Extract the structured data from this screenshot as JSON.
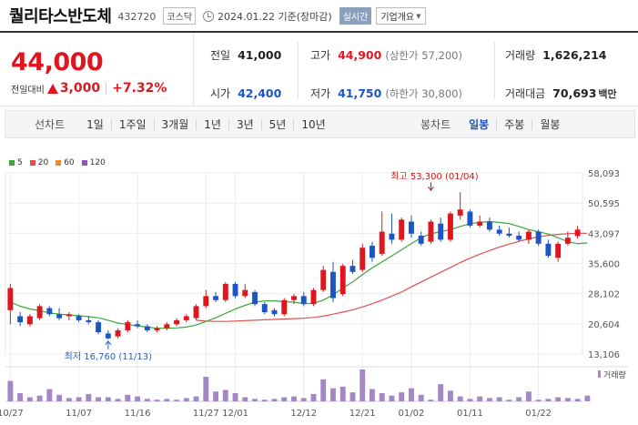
{
  "header": {
    "stock_name": "퀄리타스반도체",
    "stock_code": "432720",
    "market": "코스닥",
    "date_text": "2024.01.22 기준(장마감)",
    "realtime_label": "실시간",
    "company_label": "기업개요"
  },
  "price": {
    "current": "44,000",
    "change_label": "전일대비",
    "change_amount": "3,000",
    "change_pct": "+7.32%"
  },
  "stats": {
    "prev_label": "전일",
    "prev_value": "41,000",
    "high_label": "고가",
    "high_value": "44,900",
    "high_limit": "(상한가 57,200)",
    "volume_label": "거래량",
    "volume_value": "1,626,214",
    "open_label": "시가",
    "open_value": "42,400",
    "low_label": "저가",
    "low_value": "41,750",
    "low_limit": "(하한가 30,800)",
    "amount_label": "거래대금",
    "amount_value": "70,693",
    "amount_unit": "백만"
  },
  "toolbar": {
    "line_label": "선차트",
    "line_items": [
      "1일",
      "1주일",
      "3개월",
      "1년",
      "3년",
      "5년",
      "10년"
    ],
    "candle_label": "봉차트",
    "candle_items": [
      "일봉",
      "주봉",
      "월봉"
    ],
    "candle_active": "일봉"
  },
  "colors": {
    "up": "#e0161e",
    "down": "#1d55c4",
    "ma5": "#3ca53c",
    "ma20": "#e05050",
    "ma60": "#f08a24",
    "ma120": "#8b5ab8",
    "volume": "#a487c5"
  },
  "chart_data": {
    "type": "candlestick",
    "legend": [
      {
        "name": "5",
        "color": "#3ca53c"
      },
      {
        "name": "20",
        "color": "#e05050"
      },
      {
        "name": "60",
        "color": "#f08a24"
      },
      {
        "name": "120",
        "color": "#8b5ab8"
      }
    ],
    "y_ticks": [
      58093,
      50595,
      43097,
      35600,
      28102,
      20604,
      13106
    ],
    "y_tick_labels": [
      "58,093",
      "50,595",
      "43,097",
      "35,600",
      "28,102",
      "20,604",
      "13,106"
    ],
    "ylim": [
      13106,
      58093
    ],
    "x_tick_labels": [
      "10/27",
      "11/07",
      "11/16",
      "11/27",
      "12/01",
      "12/12",
      "12/21",
      "01/02",
      "01/11",
      "01/22"
    ],
    "x_tick_index": [
      0,
      7,
      13,
      20,
      23,
      30,
      36,
      41,
      47,
      54
    ],
    "high_annotation": "최고 53,300 (01/04)",
    "high_annotation_index": 43,
    "high_annotation_value": 53300,
    "low_annotation": "최저 16,760 (11/13)",
    "low_annotation_index": 10,
    "low_annotation_value": 16760,
    "volume_label": "거래량",
    "candles": [
      {
        "o": 24000,
        "h": 30500,
        "l": 20500,
        "c": 29500
      },
      {
        "o": 22500,
        "h": 23500,
        "l": 20000,
        "c": 21000
      },
      {
        "o": 20500,
        "h": 23000,
        "l": 20000,
        "c": 22500
      },
      {
        "o": 22000,
        "h": 25500,
        "l": 21500,
        "c": 25000
      },
      {
        "o": 24500,
        "h": 25000,
        "l": 22500,
        "c": 23000
      },
      {
        "o": 23000,
        "h": 24500,
        "l": 21500,
        "c": 22000
      },
      {
        "o": 22500,
        "h": 23500,
        "l": 21500,
        "c": 23000
      },
      {
        "o": 22500,
        "h": 23000,
        "l": 21000,
        "c": 21500
      },
      {
        "o": 21500,
        "h": 22500,
        "l": 20500,
        "c": 21000
      },
      {
        "o": 21000,
        "h": 21500,
        "l": 18000,
        "c": 18500
      },
      {
        "o": 18200,
        "h": 19000,
        "l": 16760,
        "c": 17000
      },
      {
        "o": 17500,
        "h": 19500,
        "l": 17000,
        "c": 19000
      },
      {
        "o": 19000,
        "h": 21500,
        "l": 18500,
        "c": 21000
      },
      {
        "o": 20500,
        "h": 21500,
        "l": 19500,
        "c": 20000
      },
      {
        "o": 20000,
        "h": 20500,
        "l": 18500,
        "c": 19000
      },
      {
        "o": 19000,
        "h": 20000,
        "l": 18500,
        "c": 19500
      },
      {
        "o": 19500,
        "h": 21000,
        "l": 19000,
        "c": 20500
      },
      {
        "o": 20500,
        "h": 22000,
        "l": 20000,
        "c": 21500
      },
      {
        "o": 21500,
        "h": 23000,
        "l": 21000,
        "c": 22500
      },
      {
        "o": 22000,
        "h": 25500,
        "l": 21500,
        "c": 25000
      },
      {
        "o": 25000,
        "h": 29000,
        "l": 24500,
        "c": 27500
      },
      {
        "o": 27500,
        "h": 28500,
        "l": 26000,
        "c": 26500
      },
      {
        "o": 26500,
        "h": 31000,
        "l": 26000,
        "c": 30500
      },
      {
        "o": 30500,
        "h": 31000,
        "l": 27000,
        "c": 27500
      },
      {
        "o": 27500,
        "h": 30500,
        "l": 27000,
        "c": 29000
      },
      {
        "o": 28500,
        "h": 29000,
        "l": 25000,
        "c": 25500
      },
      {
        "o": 25500,
        "h": 26000,
        "l": 23000,
        "c": 23500
      },
      {
        "o": 24000,
        "h": 24500,
        "l": 22500,
        "c": 23000
      },
      {
        "o": 23000,
        "h": 27000,
        "l": 22500,
        "c": 26500
      },
      {
        "o": 26500,
        "h": 28000,
        "l": 25500,
        "c": 27500
      },
      {
        "o": 27500,
        "h": 28500,
        "l": 25000,
        "c": 25500
      },
      {
        "o": 25500,
        "h": 29500,
        "l": 25000,
        "c": 29000
      },
      {
        "o": 29000,
        "h": 35000,
        "l": 28500,
        "c": 34000
      },
      {
        "o": 33500,
        "h": 36000,
        "l": 26000,
        "c": 27000
      },
      {
        "o": 28000,
        "h": 35500,
        "l": 27500,
        "c": 35000
      },
      {
        "o": 35000,
        "h": 36500,
        "l": 33000,
        "c": 33500
      },
      {
        "o": 34000,
        "h": 40500,
        "l": 33500,
        "c": 39500
      },
      {
        "o": 40000,
        "h": 41000,
        "l": 36000,
        "c": 37000
      },
      {
        "o": 38000,
        "h": 48500,
        "l": 37500,
        "c": 43500
      },
      {
        "o": 43000,
        "h": 48000,
        "l": 40500,
        "c": 41500
      },
      {
        "o": 41500,
        "h": 47000,
        "l": 41000,
        "c": 46500
      },
      {
        "o": 46000,
        "h": 47500,
        "l": 42000,
        "c": 43000
      },
      {
        "o": 42500,
        "h": 43500,
        "l": 40000,
        "c": 40500
      },
      {
        "o": 41000,
        "h": 46500,
        "l": 40500,
        "c": 46000
      },
      {
        "o": 45500,
        "h": 47000,
        "l": 41000,
        "c": 41500
      },
      {
        "o": 41500,
        "h": 48500,
        "l": 41000,
        "c": 48000
      },
      {
        "o": 47500,
        "h": 53300,
        "l": 46500,
        "c": 49000
      },
      {
        "o": 48500,
        "h": 49000,
        "l": 44500,
        "c": 45000
      },
      {
        "o": 45000,
        "h": 47500,
        "l": 44500,
        "c": 46000
      },
      {
        "o": 46000,
        "h": 47000,
        "l": 43500,
        "c": 44000
      },
      {
        "o": 44000,
        "h": 45000,
        "l": 42500,
        "c": 43000
      },
      {
        "o": 43000,
        "h": 44500,
        "l": 42000,
        "c": 42500
      },
      {
        "o": 42500,
        "h": 43500,
        "l": 41000,
        "c": 41500
      },
      {
        "o": 41500,
        "h": 44000,
        "l": 40500,
        "c": 43500
      },
      {
        "o": 43500,
        "h": 44000,
        "l": 40000,
        "c": 40500
      },
      {
        "o": 40500,
        "h": 41500,
        "l": 37000,
        "c": 37500
      },
      {
        "o": 37000,
        "h": 41000,
        "l": 36000,
        "c": 40500
      },
      {
        "o": 40500,
        "h": 43500,
        "l": 40000,
        "c": 42000
      },
      {
        "o": 42400,
        "h": 44900,
        "l": 41750,
        "c": 44000
      }
    ],
    "volumes": [
      25,
      10,
      5,
      7,
      15,
      8,
      4,
      5,
      9,
      5,
      5,
      3,
      8,
      6,
      3,
      2,
      3,
      2,
      4,
      6,
      30,
      12,
      14,
      10,
      5,
      3,
      2,
      3,
      5,
      6,
      4,
      9,
      27,
      16,
      18,
      11,
      39,
      15,
      10,
      7,
      11,
      16,
      8,
      2,
      21,
      13,
      6,
      3,
      6,
      4,
      5,
      2,
      5,
      12,
      2,
      3,
      5,
      4,
      3,
      7
    ],
    "ma5": [
      26000,
      25000,
      24300,
      23900,
      23300,
      23000,
      22800,
      22600,
      22400,
      22100,
      21500,
      20800,
      20400,
      20100,
      19800,
      19500,
      19500,
      19600,
      19800,
      20300,
      21200,
      22100,
      23200,
      24300,
      25200,
      26000,
      26300,
      26300,
      26100,
      26000,
      25600,
      25700,
      26500,
      27800,
      29500,
      31000,
      32800,
      34500,
      36000,
      37500,
      39000,
      40500,
      42000,
      43000,
      43500,
      44000,
      44800,
      45500,
      45800,
      46000,
      45800,
      45500,
      44800,
      44000,
      43500,
      42900,
      42000,
      41000,
      40500,
      40700
    ],
    "ma20": [
      null,
      null,
      null,
      null,
      null,
      null,
      null,
      null,
      null,
      null,
      null,
      null,
      null,
      null,
      null,
      null,
      null,
      null,
      null,
      21500,
      21300,
      21200,
      21200,
      21300,
      21400,
      21500,
      21600,
      21700,
      21800,
      21900,
      22000,
      22200,
      22500,
      23000,
      23500,
      24100,
      24800,
      25600,
      26500,
      27500,
      28500,
      29800,
      31000,
      32200,
      33400,
      34600,
      35800,
      36900,
      37900,
      38800,
      39700,
      40400,
      41100,
      41700,
      42200,
      42600,
      42800,
      43000,
      43100,
      43097
    ]
  }
}
